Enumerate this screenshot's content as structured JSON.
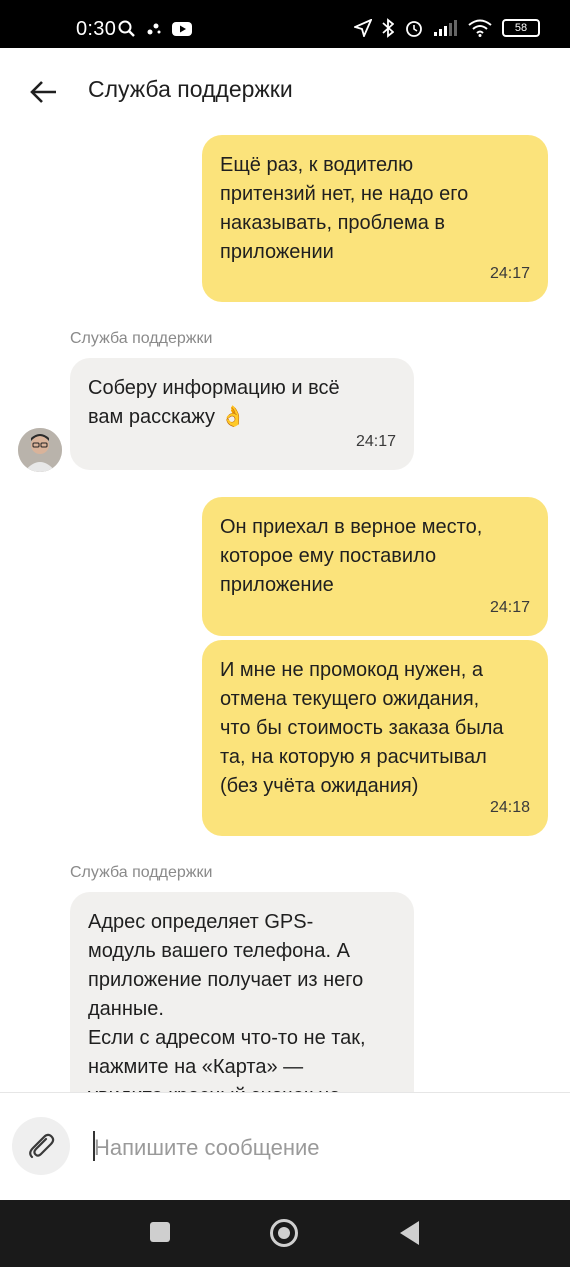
{
  "status_bar": {
    "time": "0:30",
    "battery": "58"
  },
  "header": {
    "title": "Служба поддержки"
  },
  "messages": [
    {
      "text": "Ещё раз, к водителю\nпритензий нет, не надо его\nнаказывать, проблема в\nприложении",
      "time": "24:17"
    },
    {
      "sender": "Служба поддержки",
      "text": "Соберу информацию и всё\nвам расскажу 👌",
      "time": "24:17"
    },
    {
      "text": "Он приехал в верное место,\nкоторое ему поставило\nприложение",
      "time": "24:17"
    },
    {
      "text": "И мне не промокод нужен, а\nотмена текущего ожидания,\nчто бы стоимость заказа была\nта, на которую я расчитывал\n(без учёта ожидания)",
      "time": "24:18"
    },
    {
      "sender": "Служба поддержки",
      "text": "Адрес определяет GPS-\nмодуль вашего телефона. А\nприложение получает из него\nданные.\nЕсли с адресом что-то не так,\nнажмите на «Карта» —\nувидите красный значок на"
    }
  ],
  "input": {
    "placeholder": "Напишите сообщение"
  }
}
